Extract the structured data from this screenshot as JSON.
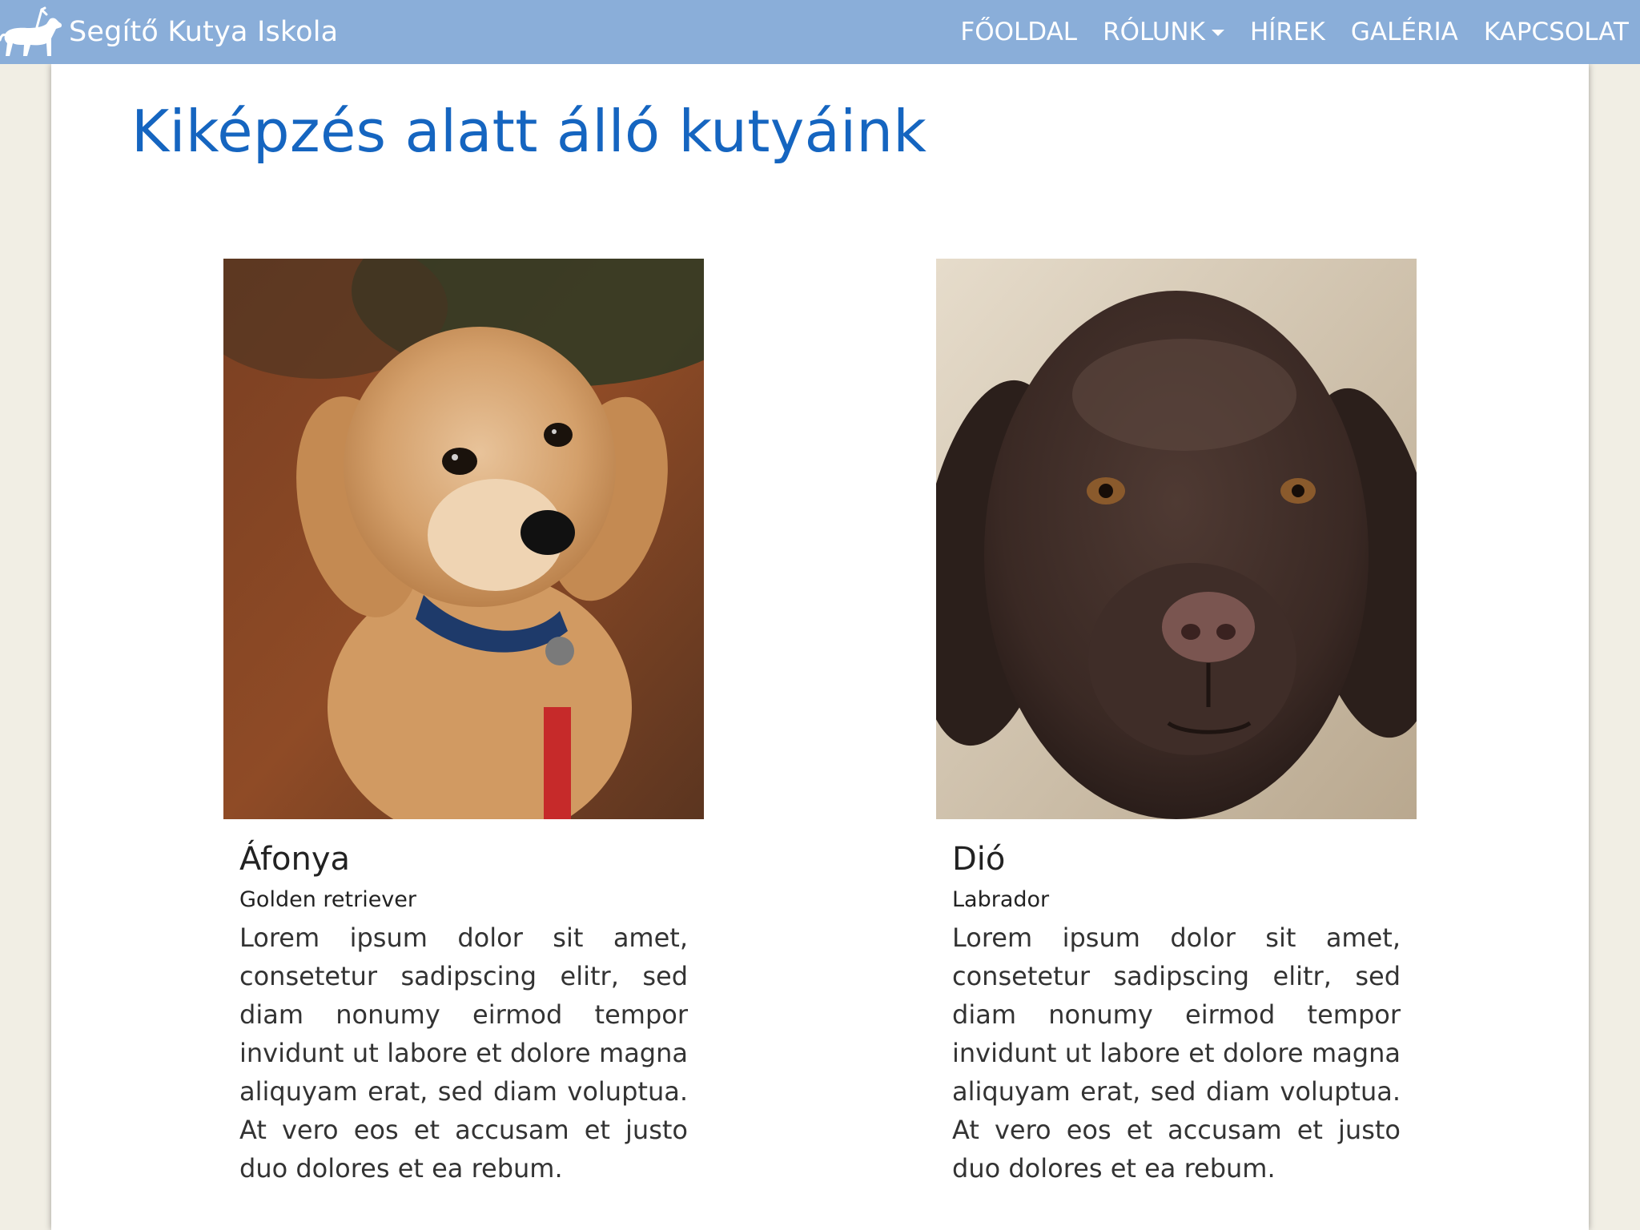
{
  "navbar": {
    "brand": "Segítő Kutya Iskola",
    "logo_icon": "guide-dog-icon",
    "background": "#8aaed9",
    "items": [
      {
        "label": "FŐOLDAL"
      },
      {
        "label": "RÓLUNK",
        "has_dropdown": true
      },
      {
        "label": "HÍREK"
      },
      {
        "label": "GALÉRIA"
      },
      {
        "label": "KAPCSOLAT"
      }
    ]
  },
  "main": {
    "title": "Kiképzés alatt álló kutyáink",
    "title_color": "#1565c0",
    "dogs": [
      {
        "name": "Áfonya",
        "breed": "Golden retriever",
        "description": "Lorem ipsum dolor sit amet, consetetur sadipscing elitr, sed diam nonumy eirmod tempor invidunt ut labore et dolore magna aliquyam erat, sed diam voluptua. At vero eos et accusam et justo duo dolores et ea rebum.",
        "photo_icon": "golden-puppy-photo"
      },
      {
        "name": "Dió",
        "breed": "Labrador",
        "description": "Lorem ipsum dolor sit amet, consetetur sadipscing elitr, sed diam nonumy eirmod tempor invidunt ut labore et dolore magna aliquyam erat, sed diam voluptua. At vero eos et accusam et justo duo dolores et ea rebum.",
        "photo_icon": "chocolate-labrador-photo"
      }
    ]
  }
}
